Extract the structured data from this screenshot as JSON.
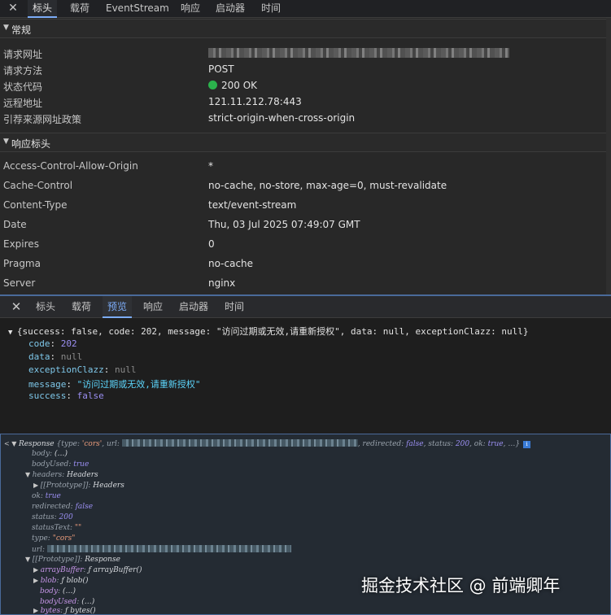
{
  "headers_panel": {
    "tabs": [
      "标头",
      "载荷",
      "EventStream",
      "响应",
      "启动器",
      "时间"
    ],
    "active_tab": "标头",
    "general": {
      "title": "常规",
      "rows": [
        {
          "key": "请求网址",
          "value": ""
        },
        {
          "key": "请求方法",
          "value": "POST"
        },
        {
          "key": "状态代码",
          "value": "200 OK"
        },
        {
          "key": "远程地址",
          "value": "121.11.212.78:443"
        },
        {
          "key": "引荐来源网址政策",
          "value": "strict-origin-when-cross-origin"
        }
      ]
    },
    "response_headers": {
      "title": "响应标头",
      "rows": [
        {
          "key": "Access-Control-Allow-Origin",
          "value": "*"
        },
        {
          "key": "Cache-Control",
          "value": "no-cache, no-store, max-age=0, must-revalidate"
        },
        {
          "key": "Content-Type",
          "value": "text/event-stream"
        },
        {
          "key": "Date",
          "value": "Thu, 03 Jul 2025 07:49:07 GMT"
        },
        {
          "key": "Expires",
          "value": "0"
        },
        {
          "key": "Pragma",
          "value": "no-cache"
        },
        {
          "key": "Server",
          "value": "nginx"
        }
      ]
    },
    "status_color": "#2bb24c"
  },
  "preview_panel": {
    "tabs": [
      "标头",
      "载荷",
      "预览",
      "响应",
      "启动器",
      "时间"
    ],
    "active_tab": "预览",
    "summary": "{success: false, code: 202, message: \"访问过期或无效,请重新授权\", data: null, exceptionClazz: null}",
    "props": [
      {
        "key": "code",
        "value": "202"
      },
      {
        "key": "data",
        "value": "null"
      },
      {
        "key": "exceptionClazz",
        "value": "null"
      },
      {
        "key": "message",
        "value": "\"访问过期或无效,请重新授权\""
      },
      {
        "key": "success",
        "value": "false"
      }
    ]
  },
  "console_panel": {
    "first_line": {
      "prefix": "Response",
      "open": "{type: ",
      "type_value": "'cors'",
      "url_label": ", url: ",
      "tail": ", redirected: ",
      "redirected": "false",
      "status_label": ", status: ",
      "status": "200",
      "ok_label": ", ok: ",
      "ok": "true",
      "end": ", …}",
      "badge": "i"
    },
    "lines": [
      {
        "key": "body",
        "sep": ": ",
        "value": "(…)"
      },
      {
        "key": "bodyUsed",
        "sep": ": ",
        "value": "true"
      },
      {
        "key": "headers",
        "sep": ": ",
        "value": "Headers"
      },
      {
        "key": "[[Prototype]]",
        "sep": ": ",
        "value": "Headers"
      },
      {
        "key": "ok",
        "sep": ": ",
        "value": "true"
      },
      {
        "key": "redirected",
        "sep": ": ",
        "value": "false"
      },
      {
        "key": "status",
        "sep": ": ",
        "value": "200"
      },
      {
        "key": "statusText",
        "sep": ": ",
        "value": "\"\""
      },
      {
        "key": "type",
        "sep": ": ",
        "value": "\"cors\""
      },
      {
        "key": "url",
        "sep": ": ",
        "value": ""
      },
      {
        "key": "[[Prototype]]",
        "sep": ": ",
        "value": "Response"
      },
      {
        "key": "arrayBuffer",
        "sep": ": ",
        "value": "ƒ arrayBuffer()"
      },
      {
        "key": "blob",
        "sep": ": ",
        "value": "ƒ blob()"
      },
      {
        "key": "body",
        "sep": ": ",
        "value": "(…)"
      },
      {
        "key": "bodyUsed",
        "sep": ": ",
        "value": "(…)"
      },
      {
        "key": "bytes",
        "sep": ": ",
        "value": "ƒ bytes()"
      }
    ]
  },
  "watermark": "掘金技术社区 @ 前端卿年"
}
